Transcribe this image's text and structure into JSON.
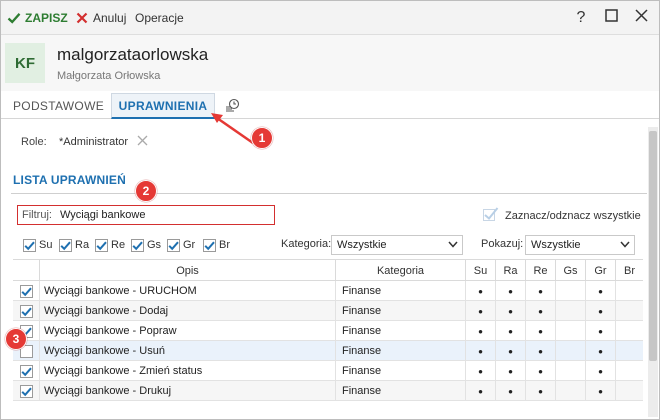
{
  "toolbar": {
    "save_label": "ZAPISZ",
    "cancel_label": "Anuluj",
    "operations_label": "Operacje",
    "help_glyph": "?",
    "save_icon": "check-icon",
    "cancel_icon": "close-icon"
  },
  "user": {
    "initials": "KF",
    "login": "malgorzataorlowska",
    "full_name": "Małgorzata Orłowska"
  },
  "tabs": {
    "basic": "PODSTAWOWE",
    "permissions": "UPRAWNIENIA",
    "history_icon": "history-icon"
  },
  "role": {
    "label": "Role:",
    "value": "*Administrator"
  },
  "section": {
    "title": "LISTA UPRAWNIEŃ"
  },
  "filter": {
    "label": "Filtruj:",
    "value": "Wyciągi bankowe"
  },
  "toggle_all": {
    "label": "Zaznacz/odznacz wszystkie"
  },
  "permission_filters": [
    {
      "label": "Su",
      "checked": true
    },
    {
      "label": "Ra",
      "checked": true
    },
    {
      "label": "Re",
      "checked": true
    },
    {
      "label": "Gs",
      "checked": true
    },
    {
      "label": "Gr",
      "checked": true
    },
    {
      "label": "Br",
      "checked": true
    }
  ],
  "category_filter": {
    "label": "Kategoria:",
    "value": "Wszystkie"
  },
  "show_filter": {
    "label": "Pokazuj:",
    "value": "Wszystkie"
  },
  "table": {
    "headers": {
      "desc": "Opis",
      "category": "Kategoria",
      "perms": [
        "Su",
        "Ra",
        "Re",
        "Gs",
        "Gr",
        "Br"
      ]
    },
    "rows": [
      {
        "checked": true,
        "desc": "Wyciągi bankowe - URUCHOM",
        "category": "Finanse",
        "perms": [
          "•",
          "•",
          "•",
          "",
          "•",
          ""
        ]
      },
      {
        "checked": true,
        "desc": "Wyciągi bankowe - Dodaj",
        "category": "Finanse",
        "perms": [
          "•",
          "•",
          "•",
          "",
          "•",
          ""
        ]
      },
      {
        "checked": true,
        "desc": "Wyciągi bankowe - Popraw",
        "category": "Finanse",
        "perms": [
          "•",
          "•",
          "•",
          "",
          "•",
          ""
        ]
      },
      {
        "checked": false,
        "desc": "Wyciągi bankowe - Usuń",
        "category": "Finanse",
        "perms": [
          "•",
          "•",
          "•",
          "",
          "•",
          ""
        ]
      },
      {
        "checked": true,
        "desc": "Wyciągi bankowe - Zmień status",
        "category": "Finanse",
        "perms": [
          "•",
          "•",
          "•",
          "",
          "•",
          ""
        ]
      },
      {
        "checked": true,
        "desc": "Wyciągi bankowe - Drukuj",
        "category": "Finanse",
        "perms": [
          "•",
          "•",
          "•",
          "",
          "•",
          ""
        ]
      }
    ]
  },
  "annotations": [
    "1",
    "2",
    "3"
  ],
  "colors": {
    "accent": "#1e70b0",
    "save_green": "#2e7d32",
    "annotation_red": "#e53935"
  }
}
